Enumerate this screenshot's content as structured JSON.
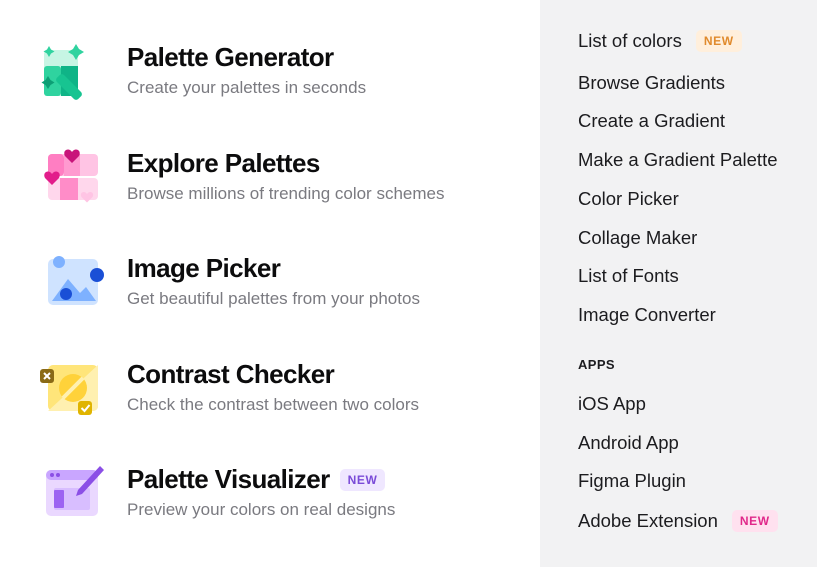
{
  "tools": [
    {
      "title": "Palette Generator",
      "subtitle": "Create your palettes in seconds",
      "icon": "magic-wand-icon"
    },
    {
      "title": "Explore Palettes",
      "subtitle": "Browse millions of trending color schemes",
      "icon": "palette-hearts-icon"
    },
    {
      "title": "Image Picker",
      "subtitle": "Get beautiful palettes from your photos",
      "icon": "image-icon"
    },
    {
      "title": "Contrast Checker",
      "subtitle": "Check the contrast between two colors",
      "icon": "contrast-icon"
    },
    {
      "title": "Palette Visualizer",
      "subtitle": "Preview your colors on real designs",
      "icon": "visualizer-icon",
      "badge": "NEW"
    }
  ],
  "links": [
    {
      "label": "List of colors",
      "badge": "NEW"
    },
    {
      "label": "Browse Gradients"
    },
    {
      "label": "Create a Gradient"
    },
    {
      "label": "Make a Gradient Palette"
    },
    {
      "label": "Color Picker"
    },
    {
      "label": "Collage Maker"
    },
    {
      "label": "List of Fonts"
    },
    {
      "label": "Image Converter"
    }
  ],
  "apps_heading": "APPS",
  "apps": [
    {
      "label": "iOS App"
    },
    {
      "label": "Android App"
    },
    {
      "label": "Figma Plugin"
    },
    {
      "label": "Adobe Extension",
      "badge": "NEW"
    }
  ],
  "colors": {
    "panel_bg": "#f2f2f3",
    "badge_purple": "#7a4bd8",
    "badge_orange": "#e08a2c",
    "badge_pink": "#e0288a"
  }
}
